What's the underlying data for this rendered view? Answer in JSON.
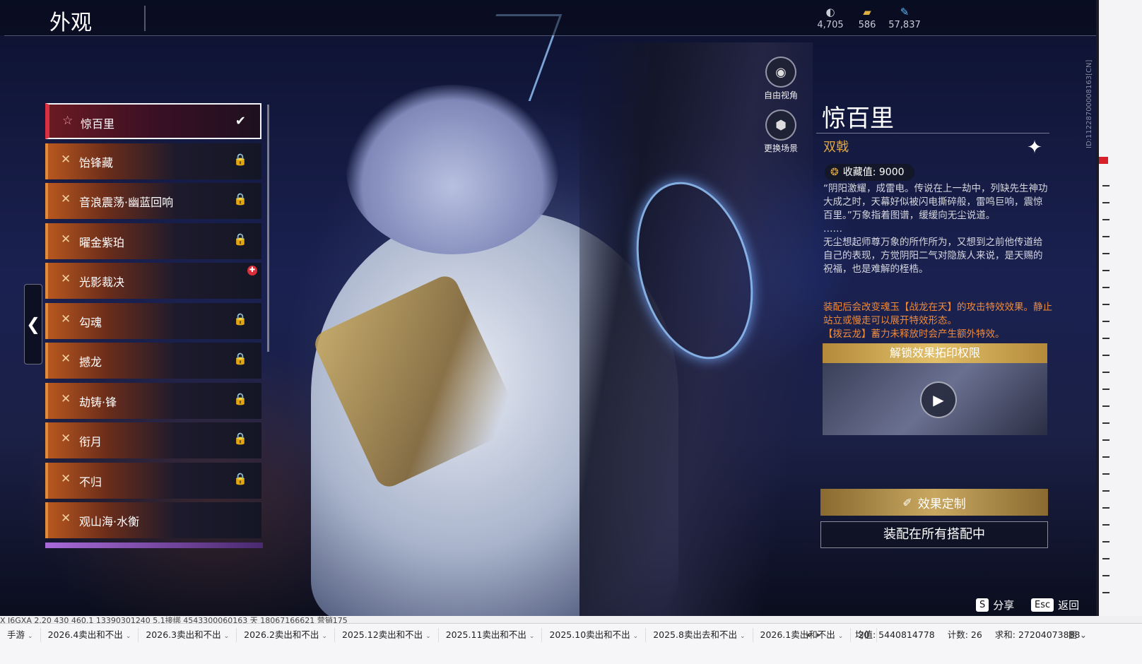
{
  "header": {
    "title": "外观",
    "currencies": [
      {
        "icon": "crystal-icon",
        "glyph": "◐",
        "value": "4,705",
        "color": "#c9cbd6"
      },
      {
        "icon": "ticket-icon",
        "glyph": "▰",
        "value": "586",
        "color": "#e0b040"
      },
      {
        "icon": "feather-icon",
        "glyph": "✎",
        "value": "57,837",
        "color": "#5ab8ff"
      }
    ]
  },
  "side_tools": {
    "free_view": "自由视角",
    "change_scene": "更换场景"
  },
  "list": {
    "items": [
      {
        "label": "惊百里",
        "state": "selected",
        "icon": "star-icon",
        "glyph": "☆",
        "right": "✔"
      },
      {
        "label": "饴锋藏",
        "state": "locked",
        "icon": "cross-icon",
        "glyph": "✕",
        "right": "🔒"
      },
      {
        "label": "音浪震荡·幽蓝回响",
        "state": "locked",
        "icon": "cross-icon",
        "glyph": "✕",
        "right": "🔒"
      },
      {
        "label": "曜金紫珀",
        "state": "locked",
        "icon": "cross-icon",
        "glyph": "✕",
        "right": "🔒"
      },
      {
        "label": "光影裁决",
        "state": "new",
        "icon": "cross-icon",
        "glyph": "✕",
        "right": ""
      },
      {
        "label": "勾魂",
        "state": "locked",
        "icon": "cross-icon",
        "glyph": "✕",
        "right": "🔒"
      },
      {
        "label": "撼龙",
        "state": "locked",
        "icon": "cross-icon",
        "glyph": "✕",
        "right": "🔒"
      },
      {
        "label": "劫铸·锋",
        "state": "locked",
        "icon": "cross-icon",
        "glyph": "✕",
        "right": "🔒"
      },
      {
        "label": "衔月",
        "state": "locked",
        "icon": "cross-icon",
        "glyph": "✕",
        "right": "🔒"
      },
      {
        "label": "不归",
        "state": "locked",
        "icon": "cross-icon",
        "glyph": "✕",
        "right": "🔒"
      },
      {
        "label": "观山海·水衡",
        "state": "unlocked",
        "icon": "cross-icon",
        "glyph": "✕",
        "right": ""
      }
    ]
  },
  "detail": {
    "name": "惊百里",
    "type": "双戟",
    "collect_label": "收藏值: 9000",
    "description": [
      "“阴阳激耀，成雷电。传说在上一劫中，列缺先生神功大成之时，天幕好似被闪电撕碎般，雷鸣巨响，震惊百里。”万象指着图谱，缓缓向无尘说道。",
      "……",
      "无尘想起师尊万象的所作所为，又想到之前他传道给自己的表现，方觉阴阳二气对隐族人来说，是天赐的祝福，也是难解的桎梏。"
    ],
    "effects": [
      "装配后会改变魂玉【战龙在天】的攻击特效效果。静止站立或慢走可以展开特效形态。",
      "【拨云龙】蓄力未释放时会产生额外特效。"
    ],
    "unlock_label": "解锁效果拓印权限",
    "custom_button": "效果定制",
    "equip_button": "装配在所有搭配中"
  },
  "hints": {
    "share_key": "S",
    "share_label": "分享",
    "back_key": "Esc",
    "back_label": "返回"
  },
  "vertical_id": "ID:11228700008163[CN]",
  "sheet": {
    "partial_row": "X J6GXA        2.20        430        460.1        13390301240        5.1接绑        4543300060163        天        18067166621        营销175",
    "tabs": [
      "手游",
      "2026.4卖出和不出",
      "2026.3卖出和不出",
      "2026.2卖出和不出",
      "2025.12卖出和不出",
      "2025.11卖出和不出",
      "2025.10卖出和不出",
      "2025.8卖出去和不出",
      "2026.1卖出和不出",
      "20"
    ],
    "avg": "均值: 5440814778",
    "count": "计数: 26",
    "sum": "求和: 27204073888",
    "zoom": "囲 ⌄"
  },
  "colors": {
    "accent_gold": "#e0a844",
    "effect_orange": "#ef8a3a",
    "selected_red": "#d83040"
  }
}
